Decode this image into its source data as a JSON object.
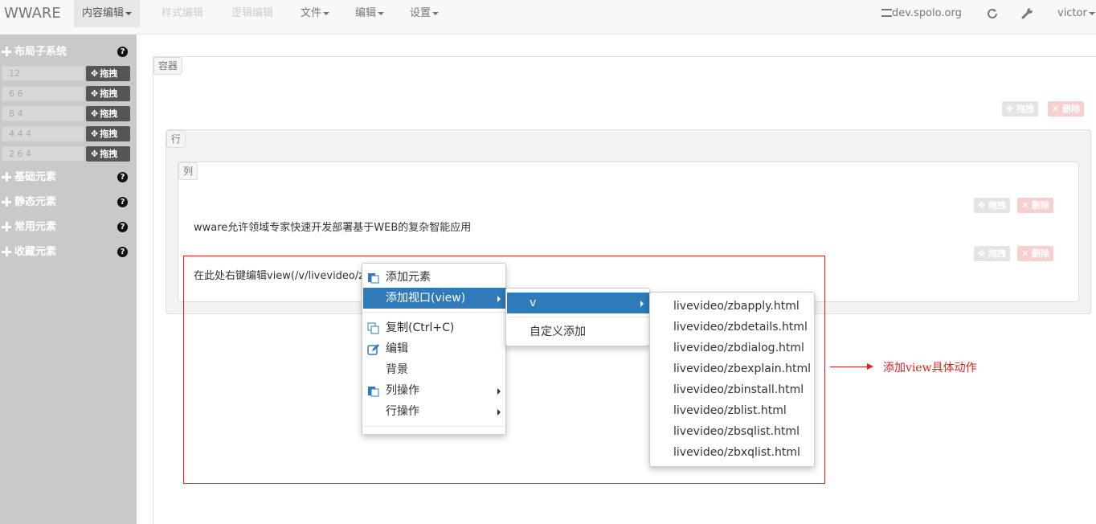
{
  "navbar": {
    "brand": "WWARE",
    "items": [
      {
        "label": "内容编辑",
        "active": true
      },
      {
        "label": "样式编辑"
      },
      {
        "label": "逻辑编辑"
      },
      {
        "label": "文件"
      },
      {
        "label": "编辑"
      },
      {
        "label": "设置"
      }
    ],
    "site": "dev.spolo.org",
    "user": "victor"
  },
  "sidebar": {
    "layout_header": "布局子系统",
    "layouts": [
      {
        "value": "12",
        "button": "拖拽"
      },
      {
        "value": "6 6",
        "button": "拖拽"
      },
      {
        "value": "8 4",
        "button": "拖拽"
      },
      {
        "value": "4 4 4",
        "button": "拖拽"
      },
      {
        "value": "2 6 4",
        "button": "拖拽"
      }
    ],
    "sections": [
      "基础元素",
      "静态元素",
      "常用元素",
      "收藏元素"
    ],
    "help": "?"
  },
  "canvas": {
    "container_tag": "容器",
    "row_tag": "行",
    "col_tag": "列",
    "drag_label": "拖拽",
    "delete_label": "删除",
    "text1": "wware允许领域专家快速开发部署基于WEB的复杂智能应用",
    "text2": "在此处右键编辑view(/v/livevideo/z"
  },
  "context_menu": {
    "items": [
      "添加元素",
      "添加视口(view)",
      "复制(Ctrl+C)",
      "编辑",
      "背景",
      "列操作",
      "行操作"
    ]
  },
  "submenu": {
    "items": [
      "v",
      "自定义添加"
    ]
  },
  "views_menu": {
    "items": [
      "livevideo/zbapply.html",
      "livevideo/zbdetails.html",
      "livevideo/zbdialog.html",
      "livevideo/zbexplain.html",
      "livevideo/zbinstall.html",
      "livevideo/zblist.html",
      "livevideo/zbsqlist.html",
      "livevideo/zbxqlist.html"
    ]
  },
  "annotation": "添加view具体动作",
  "colors": {
    "highlight": "#2f7ab9",
    "annotation": "#dd2222",
    "sidebar": "#c9c9c9"
  }
}
